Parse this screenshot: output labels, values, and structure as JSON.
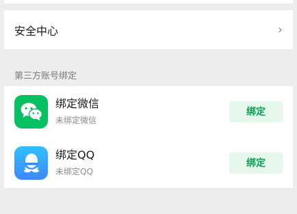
{
  "security": {
    "label": "安全中心",
    "chevron": "›",
    "chevron_icon": "chevron-right-icon"
  },
  "section": {
    "title": "第三方账号绑定"
  },
  "bindings": [
    {
      "icon": "wechat-icon",
      "title": "绑定微信",
      "subtitle": "未绑定微信",
      "button": "绑定",
      "color": "#07c160"
    },
    {
      "icon": "qq-icon",
      "title": "绑定QQ",
      "subtitle": "未绑定QQ",
      "button": "绑定",
      "color": "#3d9bff"
    }
  ],
  "colors": {
    "background": "#ededed",
    "accent_green": "#07a24f",
    "button_bg": "#e6f8ec"
  }
}
